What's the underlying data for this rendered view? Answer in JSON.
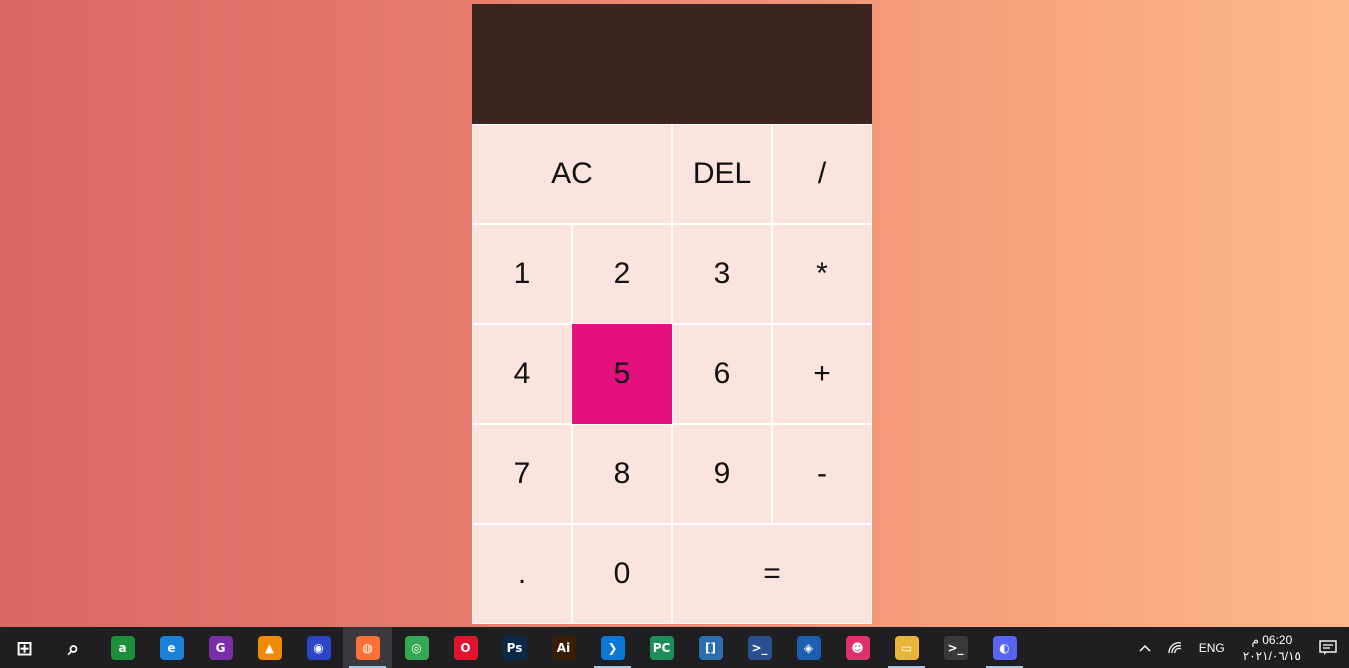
{
  "calculator": {
    "display": {
      "previous": "",
      "current": ""
    },
    "buttons": [
      {
        "label": "AC",
        "name": "all-clear-button",
        "span": 2,
        "active": false
      },
      {
        "label": "DEL",
        "name": "delete-button",
        "span": 1,
        "active": false
      },
      {
        "label": "/",
        "name": "divide-button",
        "span": 1,
        "active": false
      },
      {
        "label": "1",
        "name": "digit-1-button",
        "span": 1,
        "active": false
      },
      {
        "label": "2",
        "name": "digit-2-button",
        "span": 1,
        "active": false
      },
      {
        "label": "3",
        "name": "digit-3-button",
        "span": 1,
        "active": false
      },
      {
        "label": "*",
        "name": "multiply-button",
        "span": 1,
        "active": false
      },
      {
        "label": "4",
        "name": "digit-4-button",
        "span": 1,
        "active": false
      },
      {
        "label": "5",
        "name": "digit-5-button",
        "span": 1,
        "active": true
      },
      {
        "label": "6",
        "name": "digit-6-button",
        "span": 1,
        "active": false
      },
      {
        "label": "+",
        "name": "add-button",
        "span": 1,
        "active": false
      },
      {
        "label": "7",
        "name": "digit-7-button",
        "span": 1,
        "active": false
      },
      {
        "label": "8",
        "name": "digit-8-button",
        "span": 1,
        "active": false
      },
      {
        "label": "9",
        "name": "digit-9-button",
        "span": 1,
        "active": false
      },
      {
        "label": "-",
        "name": "subtract-button",
        "span": 1,
        "active": false
      },
      {
        "label": ".",
        "name": "decimal-button",
        "span": 1,
        "active": false
      },
      {
        "label": "0",
        "name": "digit-0-button",
        "span": 1,
        "active": false
      },
      {
        "label": "=",
        "name": "equals-button",
        "span": 2,
        "active": false
      }
    ],
    "colors": {
      "display_bg": "#3e2420",
      "button_bg": "#fbe3de",
      "active_bg": "#e4117e"
    }
  },
  "taskbar": {
    "apps": [
      {
        "name": "windows-start-icon",
        "glyph": "⊞",
        "color": "transparent",
        "active": false,
        "running": false
      },
      {
        "name": "search-icon",
        "glyph": "⌕",
        "color": "transparent",
        "active": false,
        "running": false
      },
      {
        "name": "translator-app-icon",
        "glyph": "a",
        "color": "#1c8f3a",
        "active": false,
        "running": false
      },
      {
        "name": "edge-browser-icon",
        "glyph": "e",
        "color": "#1a7fd6",
        "active": false,
        "running": false
      },
      {
        "name": "g-app-icon",
        "glyph": "G",
        "color": "#7a2fa8",
        "active": false,
        "running": false
      },
      {
        "name": "vlc-icon",
        "glyph": "▲",
        "color": "#f08a00",
        "active": false,
        "running": false
      },
      {
        "name": "audio-app-icon",
        "glyph": "◉",
        "color": "#2d45c8",
        "active": false,
        "running": false
      },
      {
        "name": "firefox-icon",
        "glyph": "◍",
        "color": "#ff7139",
        "active": true,
        "running": true
      },
      {
        "name": "chrome-icon",
        "glyph": "◎",
        "color": "#34a853",
        "active": false,
        "running": false
      },
      {
        "name": "opera-icon",
        "glyph": "O",
        "color": "#e0152b",
        "active": false,
        "running": false
      },
      {
        "name": "photoshop-icon",
        "glyph": "Ps",
        "color": "#0b2a4a",
        "active": false,
        "running": false
      },
      {
        "name": "illustrator-icon",
        "glyph": "Ai",
        "color": "#3a1d05",
        "active": false,
        "running": false
      },
      {
        "name": "vscode-icon",
        "glyph": "❯",
        "color": "#0a78d4",
        "active": false,
        "running": true
      },
      {
        "name": "pycharm-icon",
        "glyph": "PC",
        "color": "#1b8f58",
        "active": false,
        "running": false
      },
      {
        "name": "brackets-icon",
        "glyph": "[]",
        "color": "#2a6fb0",
        "active": false,
        "running": false
      },
      {
        "name": "powershell-icon",
        "glyph": ">_",
        "color": "#2a4f8f",
        "active": false,
        "running": false
      },
      {
        "name": "wireshark-icon",
        "glyph": "◈",
        "color": "#1a5fb0",
        "active": false,
        "running": false
      },
      {
        "name": "robot-app-icon",
        "glyph": "☻",
        "color": "#e0306a",
        "active": false,
        "running": false
      },
      {
        "name": "file-explorer-icon",
        "glyph": "▭",
        "color": "#e8b43a",
        "active": false,
        "running": true
      },
      {
        "name": "terminal-icon",
        "glyph": ">_",
        "color": "#3a3a3a",
        "active": false,
        "running": false
      },
      {
        "name": "discord-icon",
        "glyph": "◐",
        "color": "#5865f2",
        "active": false,
        "running": true
      }
    ],
    "tray": {
      "language": "ENG",
      "time": "06:20 م",
      "date": "٢٠٢١/٠٦/١٥"
    }
  }
}
